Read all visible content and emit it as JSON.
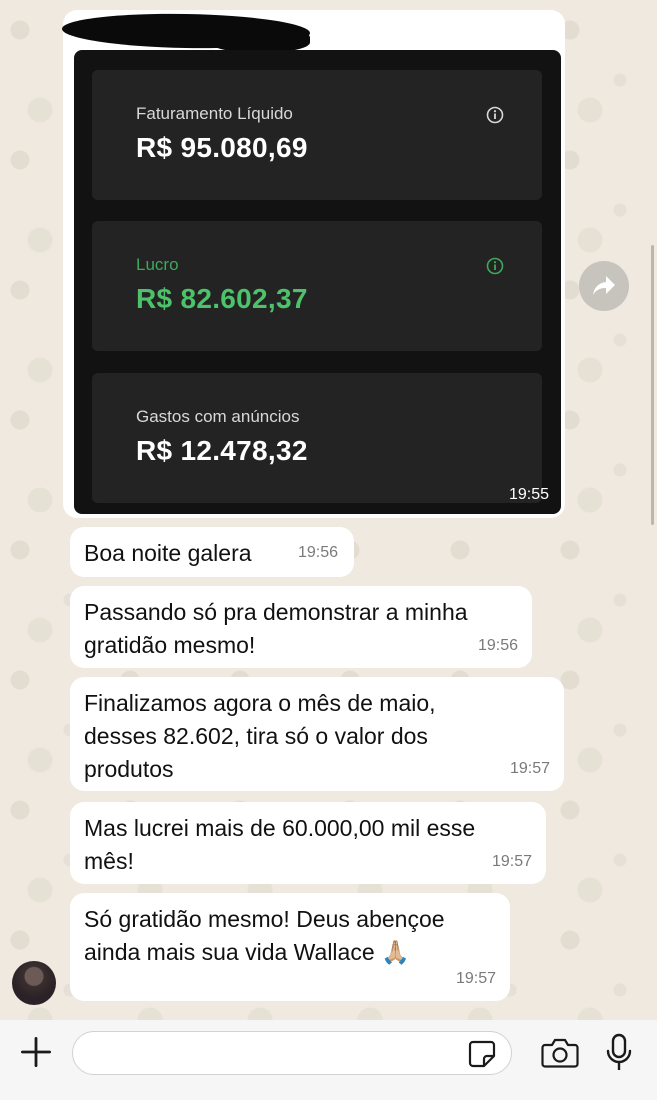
{
  "image_message": {
    "cards": [
      {
        "label": "Faturamento Líquido",
        "value": "R$ 95.080,69",
        "icon": "info-icon",
        "color": "#ffffff"
      },
      {
        "label": "Lucro",
        "value": "R$ 82.602,37",
        "icon": "info-icon",
        "color": "#4cc26a"
      },
      {
        "label": "Gastos com anúncios",
        "value": "R$ 12.478,32",
        "icon": "",
        "color": "#ffffff"
      }
    ],
    "time": "19:55"
  },
  "messages": [
    {
      "text": "Boa noite galera",
      "time": "19:56"
    },
    {
      "text": "Passando só pra demonstrar a minha\ngratidão mesmo!",
      "time": "19:56"
    },
    {
      "text": "Finalizamos agora o mês de maio,\ndesses 82.602, tira só o valor dos\nprodutos",
      "time": "19:57"
    },
    {
      "text": "Mas lucrei mais de 60.000,00 mil esse\nmês!",
      "time": "19:57"
    },
    {
      "text": "Só gratidão mesmo! Deus abençoe\nainda mais sua vida Wallace 🙏🏼",
      "time": "19:57"
    }
  ],
  "forward_icon": "forward-arrow-icon",
  "composer": {
    "placeholder": "",
    "icons": [
      "plus-icon",
      "sticker-icon",
      "camera-icon",
      "mic-icon"
    ]
  },
  "colors": {
    "chat_bg": "#efe9df",
    "bubble": "#ffffff",
    "profit_green": "#4cc26a",
    "dark_card": "#232323"
  }
}
